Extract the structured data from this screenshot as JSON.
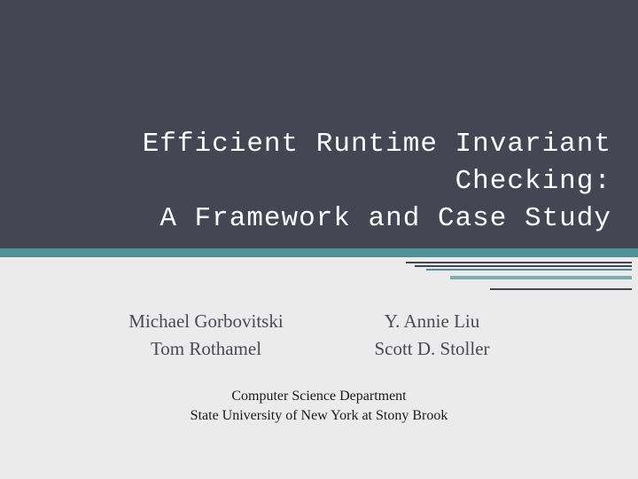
{
  "title": {
    "line1": "Efficient Runtime Invariant Checking:",
    "line2": "A Framework and Case Study"
  },
  "authors": {
    "row1": {
      "left": "Michael Gorbovitski",
      "right": "Y. Annie Liu"
    },
    "row2": {
      "left": "Tom Rothamel",
      "right": "Scott D. Stoller"
    }
  },
  "department": {
    "line1": "Computer Science Department",
    "line2": "State University of New York at Stony Brook"
  }
}
